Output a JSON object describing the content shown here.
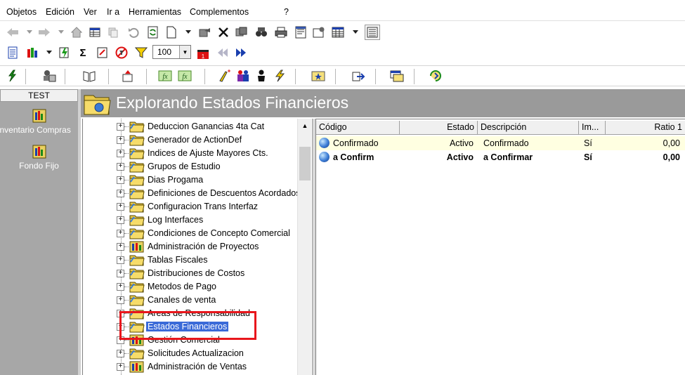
{
  "menu": [
    "Objetos",
    "Edición",
    "Ver",
    "Ir a",
    "Herramientas",
    "Complementos",
    "?"
  ],
  "toolbar": {
    "zoom_value": "100"
  },
  "sidebar": {
    "title": "TEST",
    "items": [
      {
        "label": "Inventario Compras",
        "icon": "module-icon"
      },
      {
        "label": "Fondo Fijo",
        "icon": "module-icon"
      }
    ]
  },
  "header": {
    "title": "Explorando Estados Financieros"
  },
  "tree": {
    "items": [
      {
        "label": "Deduccion Ganancias 4ta Cat",
        "icon": "folder-icon"
      },
      {
        "label": "Generador de ActionDef",
        "icon": "folder-icon"
      },
      {
        "label": "Indices de Ajuste Mayores Cts.",
        "icon": "folder-icon"
      },
      {
        "label": "Grupos de Estudio",
        "icon": "folder-icon"
      },
      {
        "label": "Dias Progama",
        "icon": "folder-icon"
      },
      {
        "label": "Definiciones de Descuentos Acordados",
        "icon": "folder-icon"
      },
      {
        "label": "Configuracion Trans Interfaz",
        "icon": "folder-icon"
      },
      {
        "label": "Log Interfaces",
        "icon": "folder-icon"
      },
      {
        "label": "Condiciones de Concepto Comercial",
        "icon": "folder-icon"
      },
      {
        "label": "Administración de Proyectos",
        "icon": "module-icon"
      },
      {
        "label": "Tablas Fiscales",
        "icon": "folder-icon"
      },
      {
        "label": "Distribuciones de Costos",
        "icon": "folder-icon"
      },
      {
        "label": "Metodos de Pago",
        "icon": "folder-icon"
      },
      {
        "label": "Canales de venta",
        "icon": "folder-icon"
      },
      {
        "label": "Areas de Responsabilidad",
        "icon": "folder-icon"
      },
      {
        "label": "Estados Financieros",
        "icon": "folder-icon",
        "selected": true
      },
      {
        "label": "Gestión Comercial",
        "icon": "module-icon"
      },
      {
        "label": "Solicitudes Actualizacion",
        "icon": "folder-icon"
      },
      {
        "label": "Administración de Ventas",
        "icon": "module-icon"
      }
    ]
  },
  "grid": {
    "columns": [
      "Código",
      "Estado",
      "Descripción",
      "Im...",
      "Ratio 1"
    ],
    "rows": [
      {
        "codigo": "Confirmado",
        "estado": "Activo",
        "descripcion": "Confirmado",
        "im": "Sí",
        "ratio": "0,00"
      },
      {
        "codigo": "a Confirm",
        "estado": "Activo",
        "descripcion": "a Confirmar",
        "im": "Sí",
        "ratio": "0,00"
      }
    ]
  },
  "colors": {
    "highlight": "#e8161c",
    "selection": "#3a6ad8",
    "header_bg": "#9a9a9a",
    "sidebar_bg": "#a7a7a7"
  }
}
